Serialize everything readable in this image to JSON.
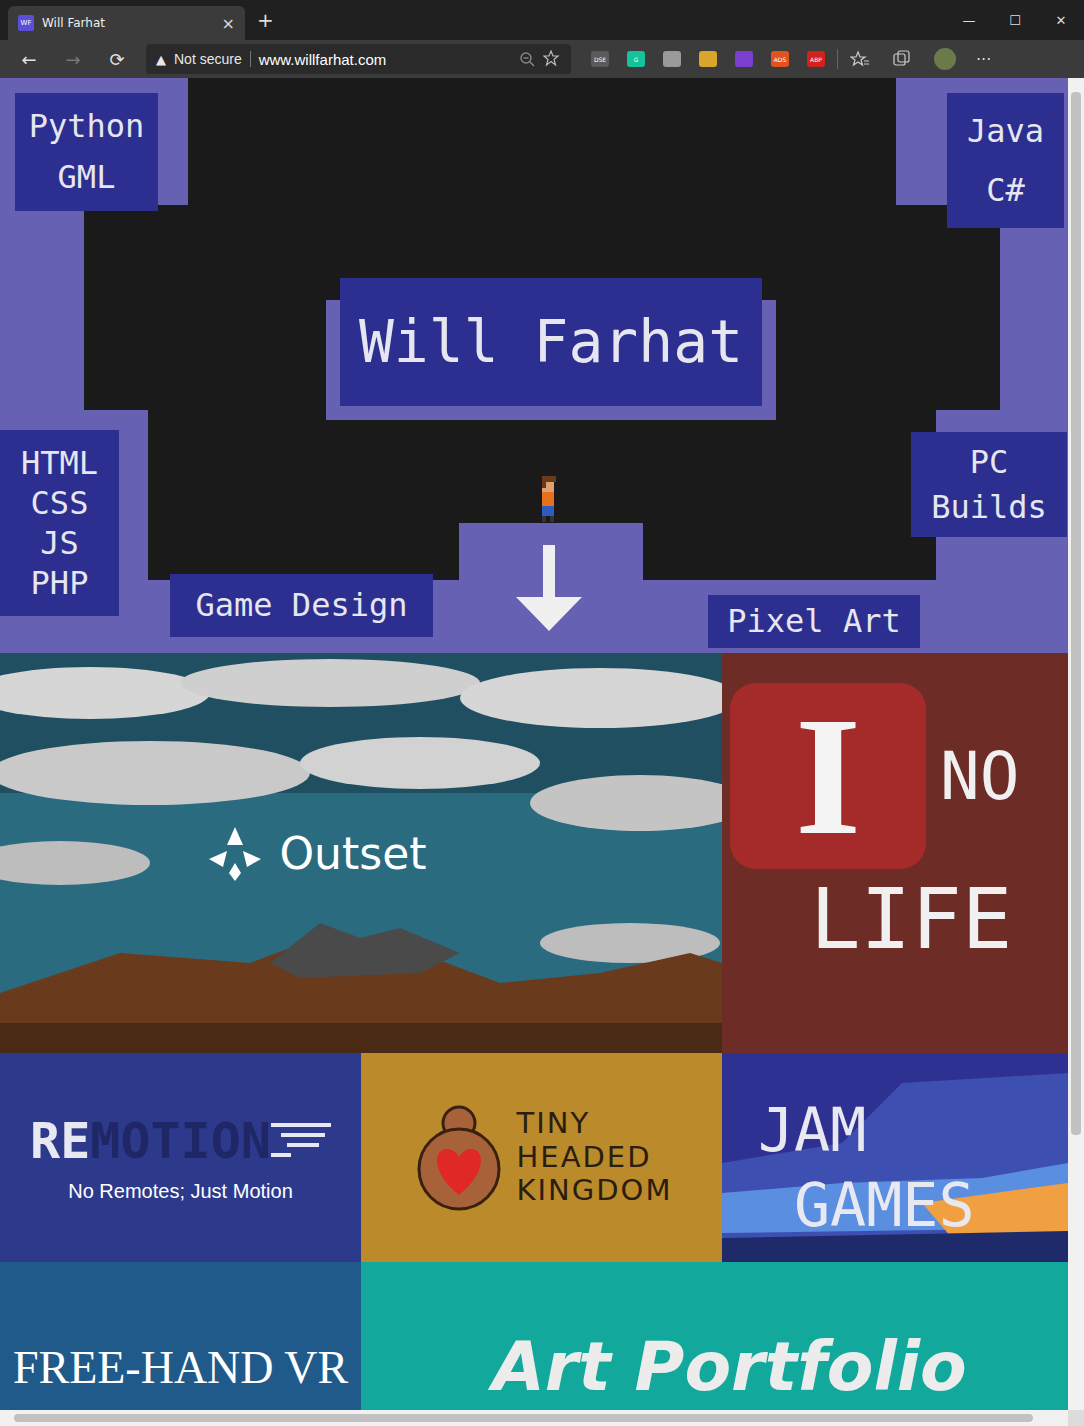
{
  "window": {
    "title": "Will Farhat",
    "favicon": "WF",
    "close_tab": "×",
    "new_tab": "+",
    "controls": [
      "—",
      "☐",
      "✕"
    ]
  },
  "toolbar": {
    "back": "←",
    "forward": "→",
    "reload": "⟳",
    "forward_disabled": true,
    "more": "···"
  },
  "address_bar": {
    "security_icon": "▲",
    "security": "Not secure",
    "url": "www.willfarhat.com"
  },
  "extensions": [
    {
      "label": "DSE",
      "color": "#5a5a5a"
    },
    {
      "label": "G",
      "color": "#15c39a"
    },
    {
      "label": "",
      "color": "#9a9a9a"
    },
    {
      "label": "",
      "color": "#d9a52b"
    },
    {
      "label": "",
      "color": "#7b3fd1"
    },
    {
      "label": "ADS",
      "color": "#e0531f"
    },
    {
      "label": "ABP",
      "color": "#d3211b"
    }
  ],
  "header": {
    "name": "Will Farhat",
    "skills": [
      {
        "lines": [
          "Python",
          "GML"
        ]
      },
      {
        "lines": [
          "Java",
          "C#"
        ]
      },
      {
        "lines": [
          "HTML",
          "CSS",
          "JS",
          "PHP"
        ]
      },
      {
        "lines": [
          "PC",
          "Builds"
        ]
      },
      {
        "lines": [
          "Game Design"
        ]
      },
      {
        "lines": [
          "Pixel Art"
        ]
      }
    ]
  },
  "tiles": [
    {
      "kind": "outset",
      "title": "Outset"
    },
    {
      "kind": "nolife",
      "letter": "I",
      "lines": [
        "NO",
        "LIFE"
      ]
    },
    {
      "kind": "remotion",
      "title": [
        "RE",
        "MOTION"
      ],
      "subtitle": "No Remotes; Just Motion"
    },
    {
      "kind": "kingdom",
      "lines": [
        "TINY",
        "HEADED",
        "KINGDOM"
      ]
    },
    {
      "kind": "jam",
      "lines": [
        "JAM",
        "GAMES"
      ]
    },
    {
      "kind": "freehand",
      "title": "FREE-HAND VR"
    },
    {
      "kind": "art",
      "title": "Art Portfolio"
    }
  ],
  "page_scroll": {
    "vertical": 0.8,
    "horizontal": 0.98
  }
}
